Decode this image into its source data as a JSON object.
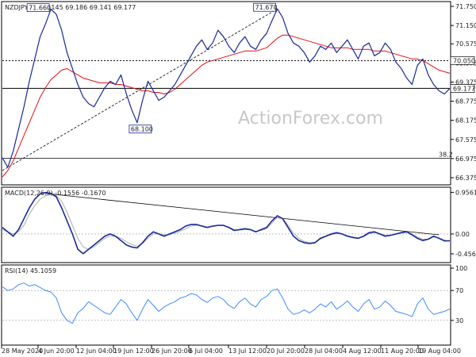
{
  "chart_data": {
    "type": "line",
    "title": "NZDJPY,H4 69.145 69.186 69.141 69.177",
    "watermark": "ActionForex.com",
    "x_ticks": [
      "28 May 2020",
      "4 Jun 20:00",
      "12 Jun 04:00",
      "19 Jun 12:00",
      "26 Jun 20:00",
      "6 Jul 04:00",
      "13 Jul 12:00",
      "20 Jul 20:00",
      "28 Jul 04:00",
      "4 Aug 12:00",
      "11 Aug 20:00",
      "19 Aug 04:00"
    ],
    "price": {
      "ylim": [
        66.2,
        71.85
      ],
      "ticks": [
        "71.750",
        "71.150",
        "70.575",
        "69.975",
        "69.375",
        "68.775",
        "68.175",
        "67.575",
        "66.975",
        "66.375"
      ],
      "series": [
        {
          "values": [
            67.0,
            66.7,
            67.2,
            67.9,
            68.6,
            69.4,
            70.1,
            70.8,
            71.2,
            71.66,
            71.5,
            71.0,
            70.3,
            69.8,
            69.3,
            68.9,
            68.7,
            68.6,
            68.9,
            69.2,
            69.4,
            69.3,
            69.6,
            69.0,
            68.5,
            68.1,
            68.8,
            69.4,
            69.1,
            68.8,
            68.9,
            69.1,
            69.3,
            69.6,
            69.9,
            70.2,
            70.5,
            70.7,
            70.4,
            70.6,
            71.0,
            70.8,
            70.5,
            70.3,
            70.6,
            70.8,
            70.5,
            70.4,
            70.7,
            70.9,
            71.3,
            71.67,
            71.4,
            70.9,
            70.6,
            70.5,
            70.3,
            70.0,
            70.2,
            70.5,
            70.4,
            70.6,
            70.3,
            70.5,
            70.7,
            70.4,
            70.1,
            70.5,
            70.6,
            70.2,
            70.3,
            70.6,
            70.4,
            70.0,
            69.8,
            69.5,
            69.3,
            69.9,
            70.1,
            69.6,
            69.3,
            69.1,
            69.0,
            69.177
          ]
        },
        {
          "values": [
            66.4,
            66.6,
            66.9,
            67.3,
            67.7,
            68.1,
            68.5,
            68.9,
            69.2,
            69.45,
            69.6,
            69.75,
            69.8,
            69.7,
            69.6,
            69.5,
            69.45,
            69.4,
            69.35,
            69.35,
            69.35,
            69.3,
            69.3,
            69.25,
            69.2,
            69.15,
            69.1,
            69.1,
            69.05,
            69.05,
            69.0,
            69.05,
            69.15,
            69.3,
            69.45,
            69.6,
            69.75,
            69.9,
            70.0,
            70.05,
            70.1,
            70.15,
            70.2,
            70.25,
            70.3,
            70.35,
            70.35,
            70.35,
            70.4,
            70.45,
            70.6,
            70.75,
            70.85,
            70.85,
            70.8,
            70.75,
            70.7,
            70.65,
            70.6,
            70.55,
            70.5,
            70.45,
            70.45,
            70.45,
            70.45,
            70.4,
            70.4,
            70.4,
            70.4,
            70.35,
            70.35,
            70.35,
            70.3,
            70.25,
            70.2,
            70.15,
            70.1,
            70.1,
            70.05,
            69.95,
            69.85,
            69.75,
            69.7,
            69.65
          ]
        }
      ],
      "hlines": [
        {
          "y": 70.05,
          "label": "70.050"
        },
        {
          "y": 69.177,
          "label": "69.177"
        },
        {
          "y": 66.98,
          "label": "38.2"
        }
      ],
      "annotations": [
        {
          "x": 9,
          "y": 71.66,
          "label": "71.660"
        },
        {
          "x": 51,
          "y": 71.67,
          "label": "71.670"
        },
        {
          "x": 25,
          "y": 68.1,
          "label": "68.100"
        }
      ]
    },
    "macd": {
      "label": "MACD(12,26,9) -0.1556 -0.1670",
      "ylim": [
        -0.62,
        1.0
      ],
      "ticks": [
        "0.9561",
        "0.00",
        "-0.4564"
      ],
      "series": [
        {
          "values": [
            0.15,
            0.05,
            -0.05,
            0.1,
            0.35,
            0.6,
            0.8,
            0.92,
            0.95,
            0.93,
            0.85,
            0.6,
            0.3,
            0.0,
            -0.35,
            -0.45,
            -0.35,
            -0.25,
            -0.15,
            -0.05,
            0.0,
            -0.05,
            -0.15,
            -0.25,
            -0.3,
            -0.32,
            -0.2,
            -0.05,
            0.05,
            0.0,
            -0.05,
            0.0,
            0.05,
            0.1,
            0.18,
            0.22,
            0.22,
            0.18,
            0.15,
            0.18,
            0.2,
            0.2,
            0.15,
            0.08,
            0.1,
            0.12,
            0.1,
            0.05,
            0.1,
            0.15,
            0.3,
            0.42,
            0.35,
            0.15,
            -0.05,
            -0.15,
            -0.2,
            -0.22,
            -0.2,
            -0.1,
            -0.05,
            0.0,
            0.03,
            0.0,
            -0.05,
            -0.08,
            -0.1,
            -0.05,
            0.03,
            0.05,
            0.0,
            -0.05,
            -0.03,
            0.0,
            0.03,
            0.05,
            -0.02,
            -0.1,
            -0.15,
            -0.12,
            -0.05,
            -0.1,
            -0.16,
            -0.1556
          ]
        },
        {
          "values": [
            0.1,
            0.05,
            0.0,
            0.05,
            0.2,
            0.45,
            0.65,
            0.8,
            0.88,
            0.9,
            0.88,
            0.75,
            0.5,
            0.2,
            -0.1,
            -0.3,
            -0.35,
            -0.3,
            -0.2,
            -0.1,
            -0.05,
            -0.05,
            -0.1,
            -0.18,
            -0.24,
            -0.28,
            -0.22,
            -0.1,
            0.0,
            0.0,
            -0.02,
            -0.02,
            0.02,
            0.06,
            0.12,
            0.18,
            0.2,
            0.19,
            0.16,
            0.17,
            0.19,
            0.19,
            0.16,
            0.1,
            0.09,
            0.1,
            0.1,
            0.06,
            0.08,
            0.12,
            0.25,
            0.38,
            0.36,
            0.2,
            0.02,
            -0.1,
            -0.17,
            -0.2,
            -0.19,
            -0.12,
            -0.06,
            -0.02,
            0.01,
            0.0,
            -0.04,
            -0.07,
            -0.09,
            -0.06,
            0.0,
            0.03,
            0.01,
            -0.03,
            -0.03,
            -0.01,
            0.02,
            0.04,
            0.0,
            -0.07,
            -0.12,
            -0.12,
            -0.07,
            -0.09,
            -0.14,
            -0.167
          ]
        }
      ]
    },
    "rsi": {
      "label": "RSI(14) 45.1059",
      "ylim": [
        0,
        100
      ],
      "ticks": [
        "100",
        "70",
        "30",
        "0"
      ],
      "levels": [
        70,
        30
      ],
      "values": [
        75,
        70,
        72,
        78,
        80,
        76,
        78,
        74,
        70,
        68,
        60,
        40,
        30,
        26,
        40,
        46,
        55,
        50,
        45,
        40,
        38,
        48,
        58,
        52,
        40,
        30,
        45,
        58,
        50,
        42,
        48,
        52,
        55,
        60,
        62,
        66,
        64,
        58,
        54,
        60,
        62,
        58,
        50,
        46,
        55,
        60,
        52,
        48,
        58,
        62,
        70,
        72,
        60,
        45,
        38,
        40,
        44,
        40,
        45,
        52,
        48,
        55,
        45,
        50,
        56,
        48,
        42,
        52,
        58,
        45,
        48,
        56,
        50,
        42,
        40,
        38,
        35,
        52,
        60,
        45,
        38,
        40,
        42,
        45.1059
      ]
    }
  }
}
